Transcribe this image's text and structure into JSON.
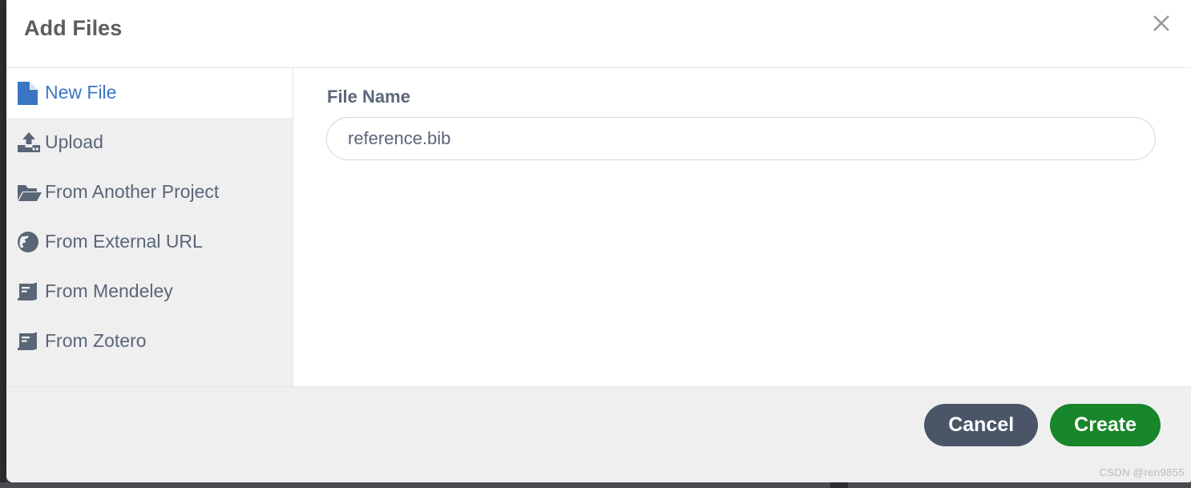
{
  "modal": {
    "title": "Add Files",
    "close_icon": "close-icon"
  },
  "sidebar": {
    "items": [
      {
        "label": "New File",
        "icon": "file-icon",
        "active": true
      },
      {
        "label": "Upload",
        "icon": "upload-icon",
        "active": false
      },
      {
        "label": "From Another Project",
        "icon": "folder-open-icon",
        "active": false
      },
      {
        "label": "From External URL",
        "icon": "globe-icon",
        "active": false
      },
      {
        "label": "From Mendeley",
        "icon": "book-icon",
        "active": false
      },
      {
        "label": "From Zotero",
        "icon": "book-icon",
        "active": false
      }
    ]
  },
  "main": {
    "field_label": "File Name",
    "filename_value": "reference.bib",
    "filename_placeholder": "reference.bib"
  },
  "footer": {
    "cancel_label": "Cancel",
    "create_label": "Create"
  },
  "watermark": "CSDN @ren9855",
  "colors": {
    "accent_blue": "#3a75c4",
    "text_slate": "#5a6678",
    "create_green": "#18862a",
    "cancel_slate": "#4a5568",
    "sidebar_gray": "#efefef",
    "title_gray": "#5d5d5d"
  }
}
